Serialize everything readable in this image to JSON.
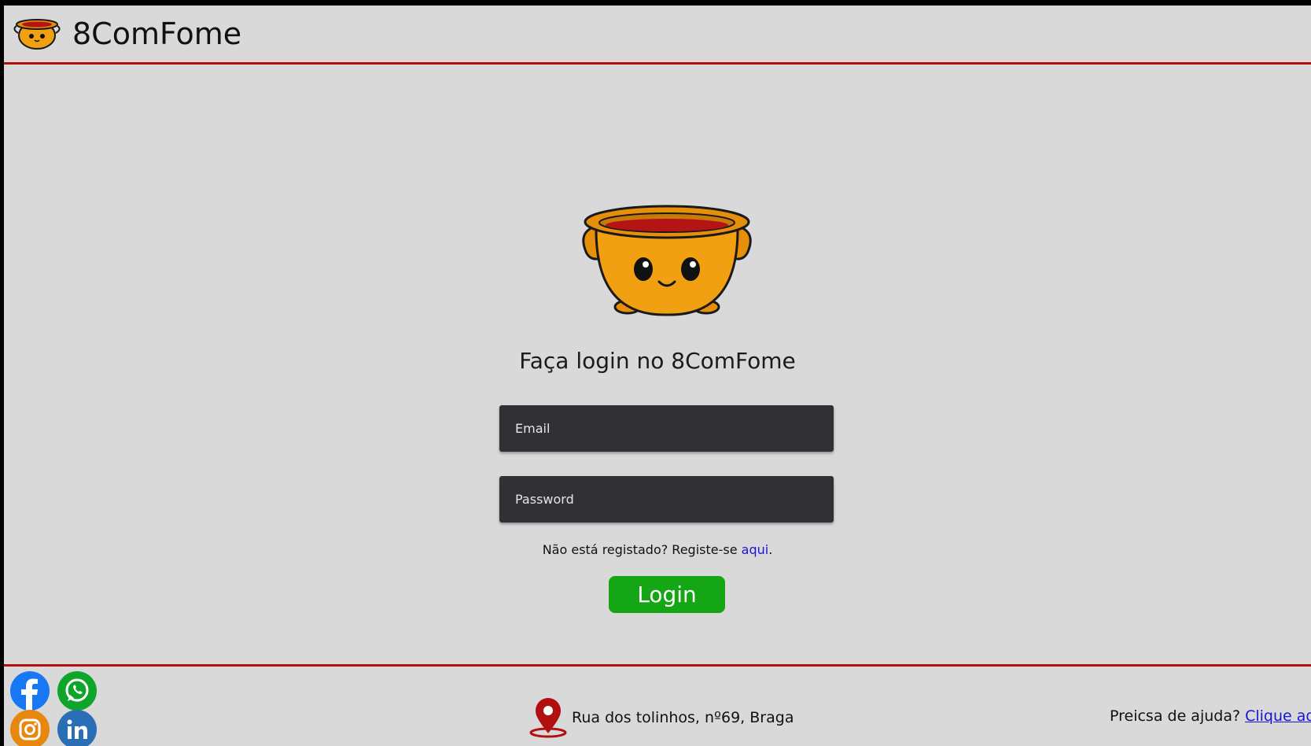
{
  "header": {
    "brand": "8ComFome"
  },
  "login": {
    "title": "Faça login no 8ComFome",
    "email_placeholder": "Email",
    "password_placeholder": "Password",
    "register_prompt": "Não está registado? Registe-se ",
    "register_link": "aqui",
    "register_suffix": ".",
    "submit_label": "Login"
  },
  "footer": {
    "address": "Rua dos tolinhos, nº69, Braga",
    "help_prompt": "Preicsa de ajuda? ",
    "help_link": "Clique aqui"
  },
  "colors": {
    "accent_line": "#b01010",
    "login_button": "#14a614",
    "field_bg": "#313034",
    "link": "#1a14d4",
    "page_bg": "#d9d9d9"
  },
  "icons": {
    "brand_logo": "pot-mascot-icon",
    "location": "map-pin-icon",
    "social": [
      "facebook-icon",
      "whatsapp-icon",
      "instagram-icon",
      "linkedin-icon"
    ]
  }
}
